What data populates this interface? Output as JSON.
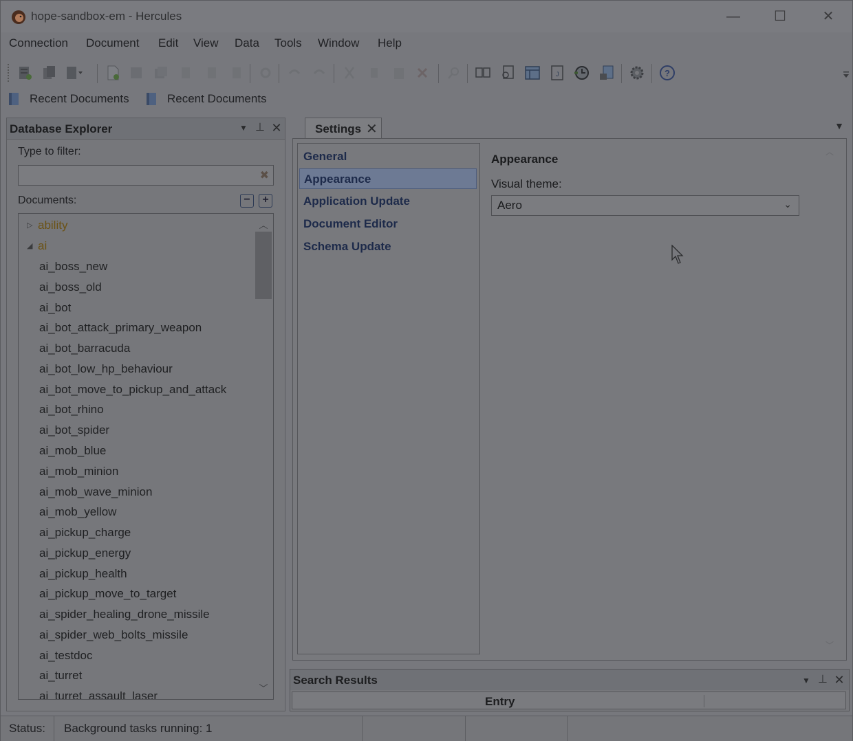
{
  "window": {
    "title": "hope-sandbox-em - Hercules",
    "minimize_glyph": "—",
    "maximize_glyph": "☐",
    "close_glyph": "✕"
  },
  "menu": [
    "Connection",
    "Document",
    "Edit",
    "View",
    "Data",
    "Tools",
    "Window",
    "Help"
  ],
  "recent_bar": {
    "items": [
      "Recent Documents",
      "Recent Documents"
    ]
  },
  "database_explorer": {
    "title": "Database Explorer",
    "filter_label": "Type to filter:",
    "filter_value": "",
    "documents_label": "Documents:",
    "tree": {
      "folders": [
        {
          "name": "ability",
          "expanded": false
        },
        {
          "name": "ai",
          "expanded": true
        }
      ],
      "items": [
        "ai_boss_new",
        "ai_boss_old",
        "ai_bot",
        "ai_bot_attack_primary_weapon",
        "ai_bot_barracuda",
        "ai_bot_low_hp_behaviour",
        "ai_bot_move_to_pickup_and_attack",
        "ai_bot_rhino",
        "ai_bot_spider",
        "ai_mob_blue",
        "ai_mob_minion",
        "ai_mob_wave_minion",
        "ai_mob_yellow",
        "ai_pickup_charge",
        "ai_pickup_energy",
        "ai_pickup_health",
        "ai_pickup_move_to_target",
        "ai_spider_healing_drone_missile",
        "ai_spider_web_bolts_missile",
        "ai_testdoc",
        "ai_turret",
        "ai_turret_assault_laser"
      ]
    }
  },
  "tabs": [
    {
      "label": "Settings",
      "active": true
    }
  ],
  "settings": {
    "nav": [
      {
        "label": "General",
        "selected": false
      },
      {
        "label": "Appearance",
        "selected": true
      },
      {
        "label": "Application Update",
        "selected": false
      },
      {
        "label": "Document Editor",
        "selected": false
      },
      {
        "label": "Schema Update",
        "selected": false
      }
    ],
    "content": {
      "title": "Appearance",
      "visual_theme_label": "Visual theme:",
      "visual_theme_value": "Aero"
    }
  },
  "search_results": {
    "title": "Search Results",
    "columns": [
      "Entry"
    ]
  },
  "status_bar": {
    "label": "Status:",
    "message": "Background tasks running: 1"
  },
  "colors": {
    "overlay_dim": "#77787d",
    "selection": "#6d7a94",
    "folder_text": "#6b5215"
  }
}
